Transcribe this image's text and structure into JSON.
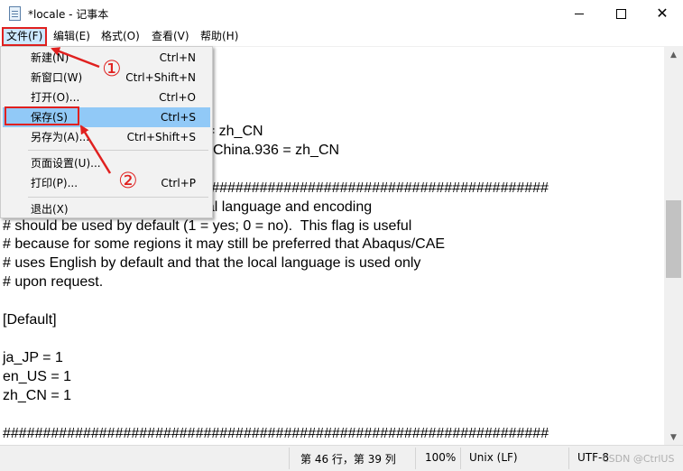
{
  "window": {
    "title": "*locale - 记事本",
    "minimize_glyph": "",
    "close_glyph": "✕"
  },
  "menubar": {
    "file": "文件(F)",
    "edit": "编辑(E)",
    "format": "格式(O)",
    "view": "查看(V)",
    "help": "帮助(H)"
  },
  "file_menu": {
    "new": {
      "label": "新建(N)",
      "shortcut": "Ctrl+N"
    },
    "new_window": {
      "label": "新窗口(W)",
      "shortcut": "Ctrl+Shift+N"
    },
    "open": {
      "label": "打开(O)...",
      "shortcut": "Ctrl+O"
    },
    "save": {
      "label": "保存(S)",
      "shortcut": "Ctrl+S"
    },
    "save_as": {
      "label": "另存为(A)...",
      "shortcut": "Ctrl+Shift+S"
    },
    "page_setup": {
      "label": "页面设置(U)...",
      "shortcut": ""
    },
    "print": {
      "label": "打印(P)...",
      "shortcut": "Ctrl+P"
    },
    "exit": {
      "label": "退出(X)",
      "shortcut": ""
    }
  },
  "editor": {
    "text": "                                    hina.936 = zh_CN\n                                    epublic of China.936 = zh_CN\n                                    = zh_CN\n                                    ##################################################\n                                    er the local language and encoding\n# should be used by default (1 = yes; 0 = no).  This flag is useful\n# because for some regions it may still be preferred that Abaqus/CAE\n# uses English by default and that the local language is used only\n# upon request.\n\n[Default]\n\nja_JP = 1\nen_US = 1\nzh_CN = 1\n\n####################################################################"
  },
  "statusbar": {
    "position": "第 46 行，第 39 列",
    "zoom": "100%",
    "line_ending": "Unix (LF)",
    "encoding": "UTF-8",
    "watermark": "CSDN @CtrlUS"
  },
  "annotations": {
    "step1": "①",
    "step2": "②",
    "color": "#e0201f"
  }
}
